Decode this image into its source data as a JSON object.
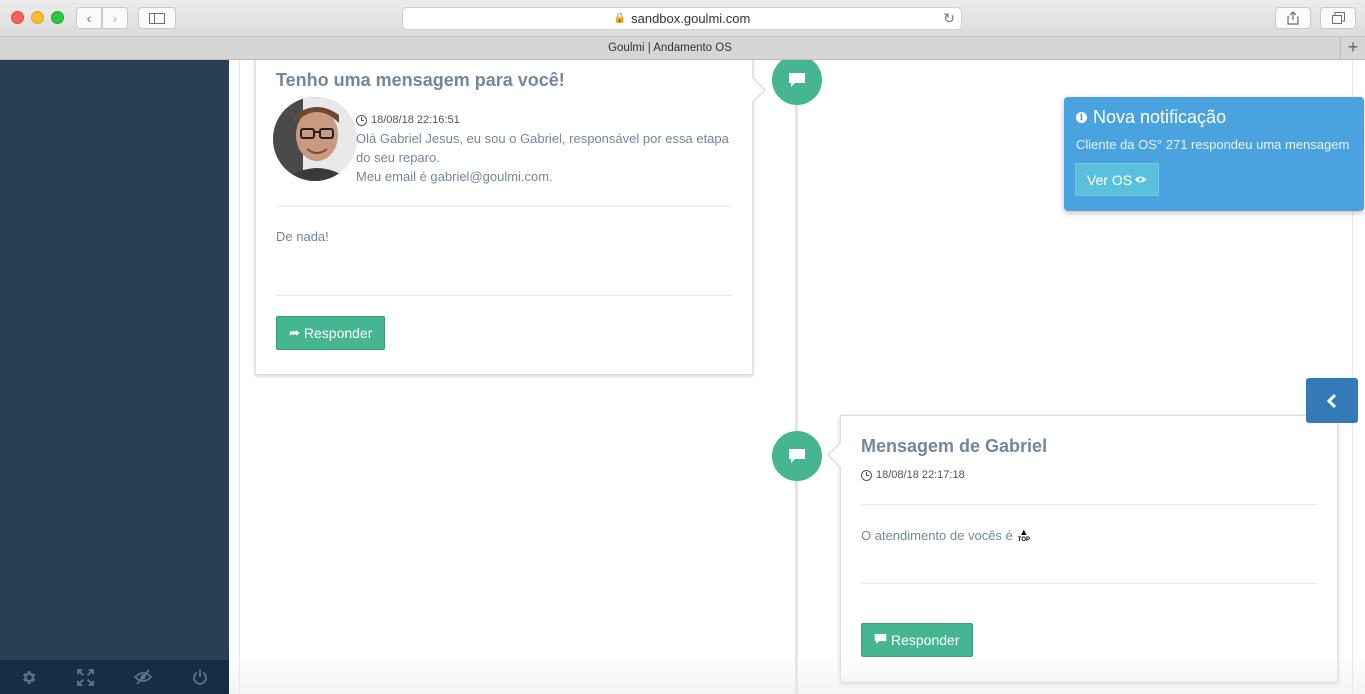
{
  "browser": {
    "url": "sandbox.goulmi.com",
    "tab_title": "Goulmi | Andamento OS"
  },
  "timeline": [
    {
      "title": "Tenho uma mensagem para você!",
      "time": "18/08/18 22:16:51",
      "message_lines": [
        "Olá Gabriel Jesus, eu sou o Gabriel, responsável por essa etapa",
        "do seu reparo.",
        "Meu email é gabriel@goulmi.com."
      ],
      "reply": "De nada!",
      "button_label": "Responder",
      "button_icon": "share-icon"
    },
    {
      "title": "Mensagem de Gabriel",
      "time": "18/08/18 22:17:18",
      "message": "O atendimento de vocês é",
      "emoji_label": "TOP",
      "button_label": "Responder",
      "button_icon": "comment-icon"
    }
  ],
  "notification": {
    "title": "Nova notificação",
    "text": "Cliente da OS° 271 respondeu uma mensagem",
    "button_label": "Ver OS"
  },
  "colors": {
    "sidebar": "#2a3f54",
    "sidebar_footer": "#172d44",
    "accent_green": "#45b592",
    "notification_blue": "#4aa3df",
    "toggle_blue": "#337ab7"
  },
  "sidebar_footer_icons": [
    "gear-icon",
    "fullscreen-icon",
    "eye-slash-icon",
    "power-icon"
  ]
}
